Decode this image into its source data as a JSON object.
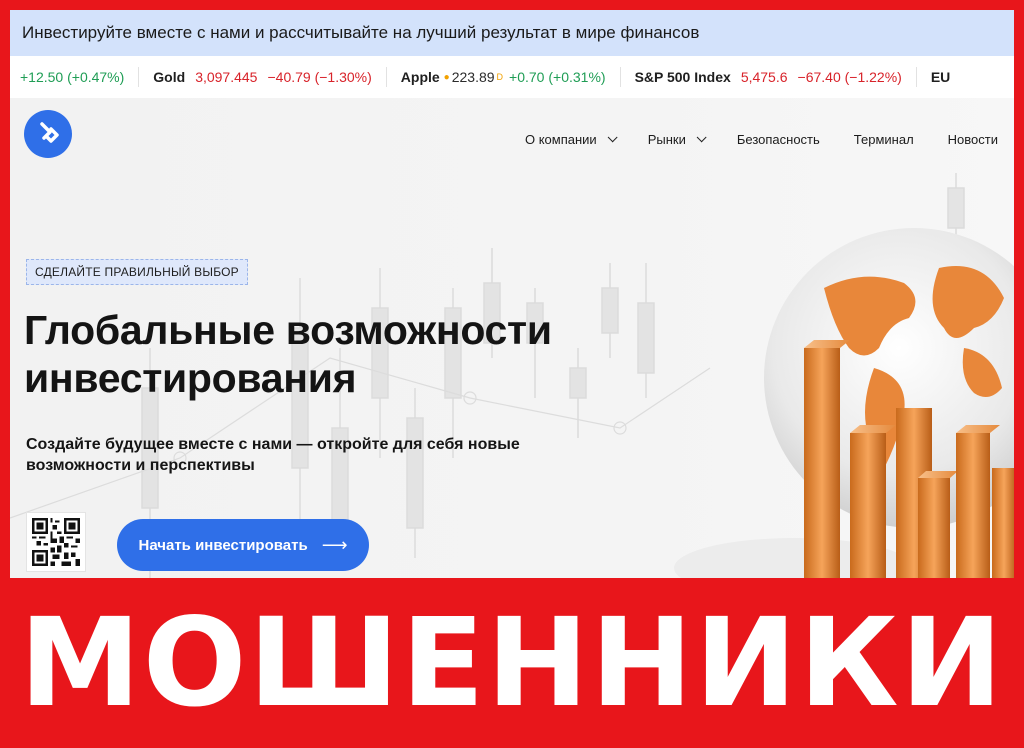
{
  "banner": {
    "text": "Инвестируйте вместе с нами и рассчитывайте на лучший результат в мире финансов"
  },
  "ticker": {
    "first_change": "+12.50 (+0.47%)",
    "items": [
      {
        "name": "Gold",
        "price": "3,097.445",
        "change": "−40.79 (−1.30%)"
      },
      {
        "name": "Apple",
        "price": "223.89",
        "sup": "D",
        "change": "+0.70 (+0.31%)"
      },
      {
        "name": "S&P 500 Index",
        "price": "5,475.6",
        "change": "−67.40 (−1.22%)"
      },
      {
        "name": "EU"
      }
    ]
  },
  "nav": {
    "items": [
      {
        "label": "О компании",
        "dropdown": true
      },
      {
        "label": "Рынки",
        "dropdown": true
      },
      {
        "label": "Безопасность",
        "dropdown": false
      },
      {
        "label": "Терминал",
        "dropdown": false
      },
      {
        "label": "Новости",
        "dropdown": false
      }
    ]
  },
  "hero": {
    "badge": "СДЕЛАЙТЕ ПРАВИЛЬНЫЙ ВЫБОР",
    "title": "Глобальные возможности инвестирования",
    "subtitle": "Создайте будущее вместе с нами — откройте для себя новые возможности и перспективы",
    "cta_label": "Начать инвестировать"
  },
  "icons": {
    "logo": "brand-logo-icon",
    "qr": "qr-code-icon",
    "arrow": "arrow-right-icon",
    "globe": "globe-icon"
  },
  "colors": {
    "accent": "#2f6fe8",
    "negative": "#d8232a",
    "positive": "#1f9d55",
    "warning_bg": "#e8161b",
    "banner_bg": "#d3e2fb"
  },
  "overlay": {
    "text": "МОШЕННИКИ"
  }
}
